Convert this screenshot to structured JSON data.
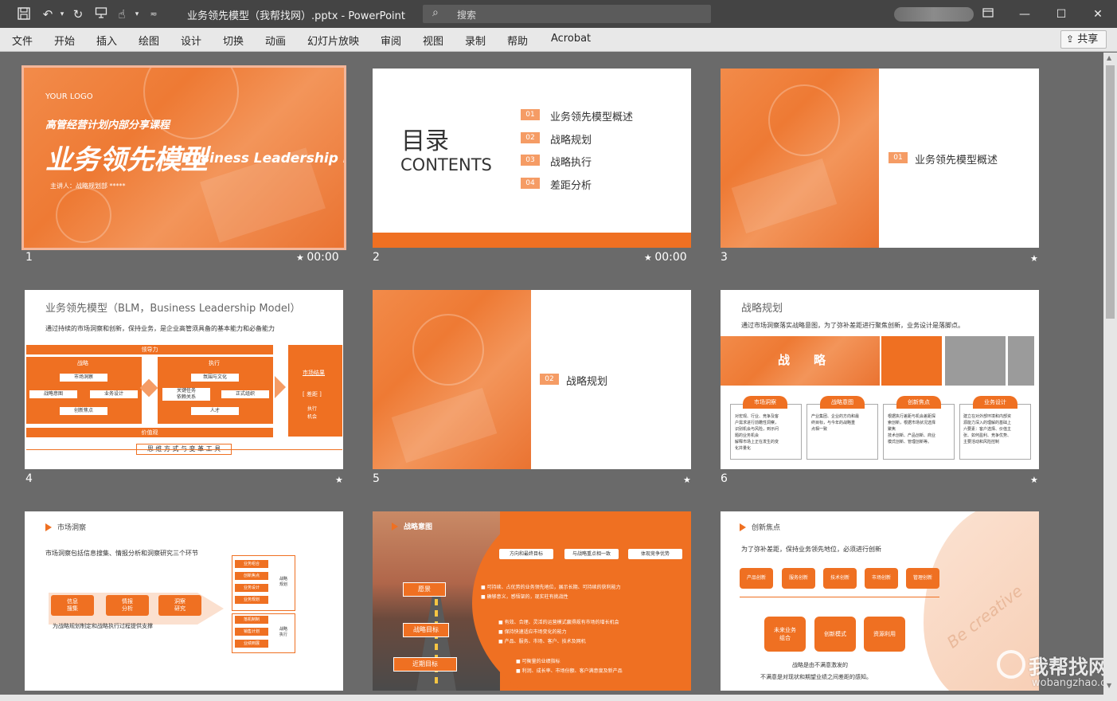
{
  "window": {
    "title": "业务领先模型（我帮找网）.pptx - PowerPoint",
    "search_placeholder": "搜索"
  },
  "menu": {
    "items": [
      "文件",
      "开始",
      "插入",
      "绘图",
      "设计",
      "切换",
      "动画",
      "幻灯片放映",
      "审阅",
      "视图",
      "录制",
      "帮助",
      "Acrobat"
    ],
    "share_label": "共享"
  },
  "icons": [
    "save-icon",
    "undo-icon",
    "redo-icon",
    "present-icon",
    "touch-mode-icon",
    "customize-qat-icon",
    "search-icon",
    "ribbon-display-icon",
    "minimize-icon",
    "maximize-icon",
    "close-icon",
    "share-icon",
    "star-icon"
  ],
  "colors": {
    "accent": "#ef7022",
    "titlebar": "#444444",
    "canvas": "#6a6a6a",
    "selection": "#f3b69a"
  },
  "slides": [
    {
      "num": "1",
      "time": "00:00",
      "logo": "YOUR LOGO",
      "subtitle": "高管经营计划内部分享课程",
      "title": "业务领先模型",
      "title_en": "Business Leadership Model",
      "presenter": "主讲人：战略规划部 *****"
    },
    {
      "num": "2",
      "time": "00:00",
      "heading": "目录",
      "heading_en": "CONTENTS",
      "items": [
        {
          "no": "01",
          "label": "业务领先模型概述"
        },
        {
          "no": "02",
          "label": "战略规划"
        },
        {
          "no": "03",
          "label": "战略执行"
        },
        {
          "no": "04",
          "label": "差距分析"
        }
      ]
    },
    {
      "num": "3",
      "section_no": "01",
      "section_label": "业务领先模型概述"
    },
    {
      "num": "4",
      "title": "业务领先模型（BLM，Business Leadership Model）",
      "desc": "通过持续的市场洞察和创新，保持业务，是企业高管须具备的基本能力和必备能力",
      "leadership": "领导力",
      "strategy": "战略",
      "strategy_items": [
        "市场洞察",
        "战略意图",
        "业务设计",
        "创新焦点"
      ],
      "execution": "执行",
      "execution_items": [
        "氛围与文化",
        "关键任务\n依赖关系",
        "正式组织",
        "人才"
      ],
      "result": "市场结果",
      "gap": "[ 差距 ]",
      "exec_mech": "执行\n机会",
      "values": "价值观",
      "tools": "思 维 方 式 与 变 革 工 具"
    },
    {
      "num": "5",
      "section_no": "02",
      "section_label": "战略规划"
    },
    {
      "num": "6",
      "title": "战略规划",
      "desc": "通过市场洞察落实战略意图，为了弥补差距进行聚焦创新，业务设计是落脚点。",
      "band_text": "战　　略",
      "cards": [
        {
          "title": "市场洞察",
          "lines": [
            "对宏观、行业、竞争及客",
            "户需求进行前瞻性洞察，",
            "识别机会与风险，到示问",
            "题的业务机会",
            "解释市场上正在发生的变",
            "化并量化"
          ]
        },
        {
          "title": "战略意图",
          "lines": [
            "产业集团、企业的方向和最",
            "终目标，与今年的战略重",
            "点相一致"
          ]
        },
        {
          "title": "创新焦点",
          "lines": [
            "根据执行差距与机会差距探",
            "索创新，根据市场状况选择",
            "聚焦",
            "技术创新、产品创新、商业",
            "模式创新、管理创新等。"
          ]
        },
        {
          "title": "业务设计",
          "lines": [
            "建立在对外部环境和内部资",
            "源能力深入的理解的基础上",
            "六要素：客户选择、价值主",
            "张、如何盈利、竞争优势、",
            "主要活动和风险控制"
          ]
        }
      ]
    },
    {
      "num": "",
      "title": "市场洞察",
      "desc": "市场洞察包括信息搜集、情报分析和洞察研究三个环节",
      "steps": [
        "信息\n搜集",
        "情报\n分析",
        "洞察\n研究"
      ],
      "support": "为战略规划制定和战略执行过程提供支撑",
      "group1": [
        "业务组合",
        "创新焦点",
        "业务设计",
        "业务规划"
      ],
      "group1_label": "战略\n规划",
      "group2": [
        "落机制制",
        "销售计划",
        "业绩到展"
      ],
      "group2_label": "战略\n执行"
    },
    {
      "num": "",
      "title": "战略意图",
      "pills": [
        "方向和最终目标",
        "与战略重点相一致",
        "体现竞争优势"
      ],
      "labels": [
        "愿景",
        "战略目标",
        "近期目标"
      ],
      "bullets1": [
        "可持续、占优势的业务领先地位，展示长期、可持续的获利能力",
        "确够意义，感悟架的，现实柱有挑战性"
      ],
      "bullets2": [
        "有效、合理、灵活的运营模式赢得规有市场的增长机会",
        "保持快速适应市场变化的能力",
        "产品、服务、市场、客户、技术及网机"
      ],
      "bullets3": [
        "可衡量的业绩指标",
        "利润、成长率、市场份额、客户满意度及新产品"
      ]
    },
    {
      "num": "",
      "title": "创新焦点",
      "desc": "为了弥补差距，保持业务领先地位，必须进行创新",
      "top": [
        "产品创新",
        "服务创新",
        "技术创新",
        "市场创新",
        "管理创新"
      ],
      "mid": [
        "未来业务\n组合",
        "创新模式",
        "资源利用"
      ],
      "note1": "战略是由不满意激发的",
      "note2": "不满意是对现状和期望业绩之间差距的感知。",
      "script": "Be creative"
    }
  ],
  "watermark": {
    "main": "我帮找网",
    "sub": "wobangzhao.com"
  }
}
